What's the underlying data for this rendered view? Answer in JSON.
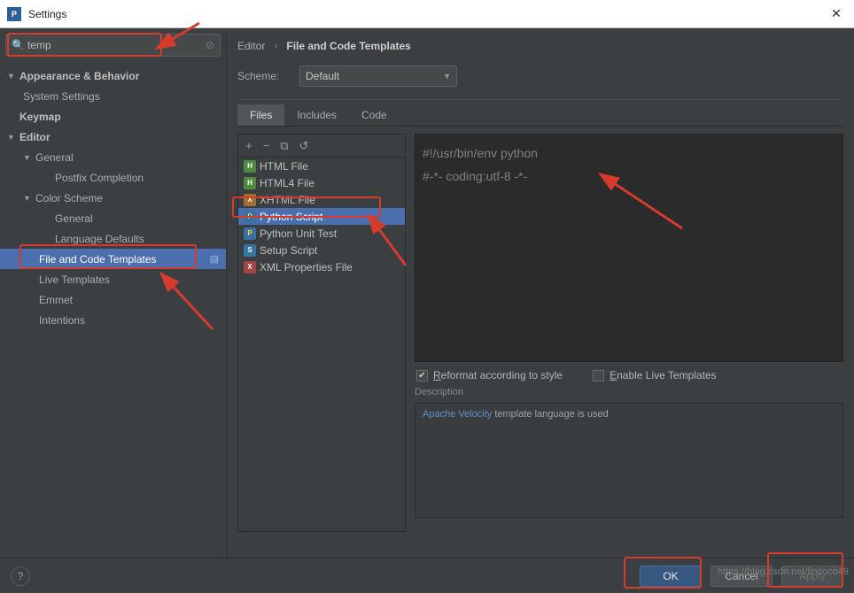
{
  "window": {
    "title": "Settings"
  },
  "search": {
    "value": "temp"
  },
  "sidebar": {
    "items": [
      {
        "label": "Appearance & Behavior",
        "type": "group"
      },
      {
        "label": "System Settings",
        "type": "leaf"
      },
      {
        "label": "Keymap",
        "type": "bold-leaf"
      },
      {
        "label": "Editor",
        "type": "group"
      },
      {
        "label": "General",
        "type": "sub-group"
      },
      {
        "label": "Postfix Completion",
        "type": "leaf"
      },
      {
        "label": "Color Scheme",
        "type": "sub-group"
      },
      {
        "label": "General",
        "type": "leaf"
      },
      {
        "label": "Language Defaults",
        "type": "leaf"
      },
      {
        "label": "File and Code Templates",
        "type": "leaf",
        "selected": true
      },
      {
        "label": "Live Templates",
        "type": "leaf"
      },
      {
        "label": "Emmet",
        "type": "leaf"
      },
      {
        "label": "Intentions",
        "type": "leaf"
      }
    ]
  },
  "breadcrumb": {
    "part1": "Editor",
    "part2": "File and Code Templates"
  },
  "scheme": {
    "label": "Scheme:",
    "value": "Default"
  },
  "tabs": {
    "items": [
      "Files",
      "Includes",
      "Code"
    ],
    "active": 0
  },
  "toolbar": {
    "add": "+",
    "remove": "−",
    "copy": "⧉",
    "revert": "↺"
  },
  "templates": {
    "items": [
      {
        "icon": "h",
        "label": "HTML File"
      },
      {
        "icon": "h",
        "label": "HTML4 File"
      },
      {
        "icon": "x",
        "label": "XHTML File"
      },
      {
        "icon": "p",
        "label": "Python Script",
        "selected": true
      },
      {
        "icon": "p",
        "label": "Python Unit Test"
      },
      {
        "icon": "s",
        "label": "Setup Script"
      },
      {
        "icon": "xm",
        "label": "XML Properties File"
      }
    ]
  },
  "editor": {
    "line1": "#!/usr/bin/env python",
    "line2": "#-*- coding:utf-8 -*-"
  },
  "options": {
    "reformat_prefix": "R",
    "reformat_rest": "eformat according to style",
    "reformat_checked": true,
    "live_prefix": "E",
    "live_rest": "nable Live Templates",
    "live_checked": false
  },
  "description": {
    "label": "Description",
    "link": "Apache Velocity",
    "rest": " template language is used"
  },
  "footer": {
    "ok": "OK",
    "cancel": "Cancel",
    "apply": "Apply"
  },
  "watermark": "https://blog.csdn.net/lincoco49"
}
